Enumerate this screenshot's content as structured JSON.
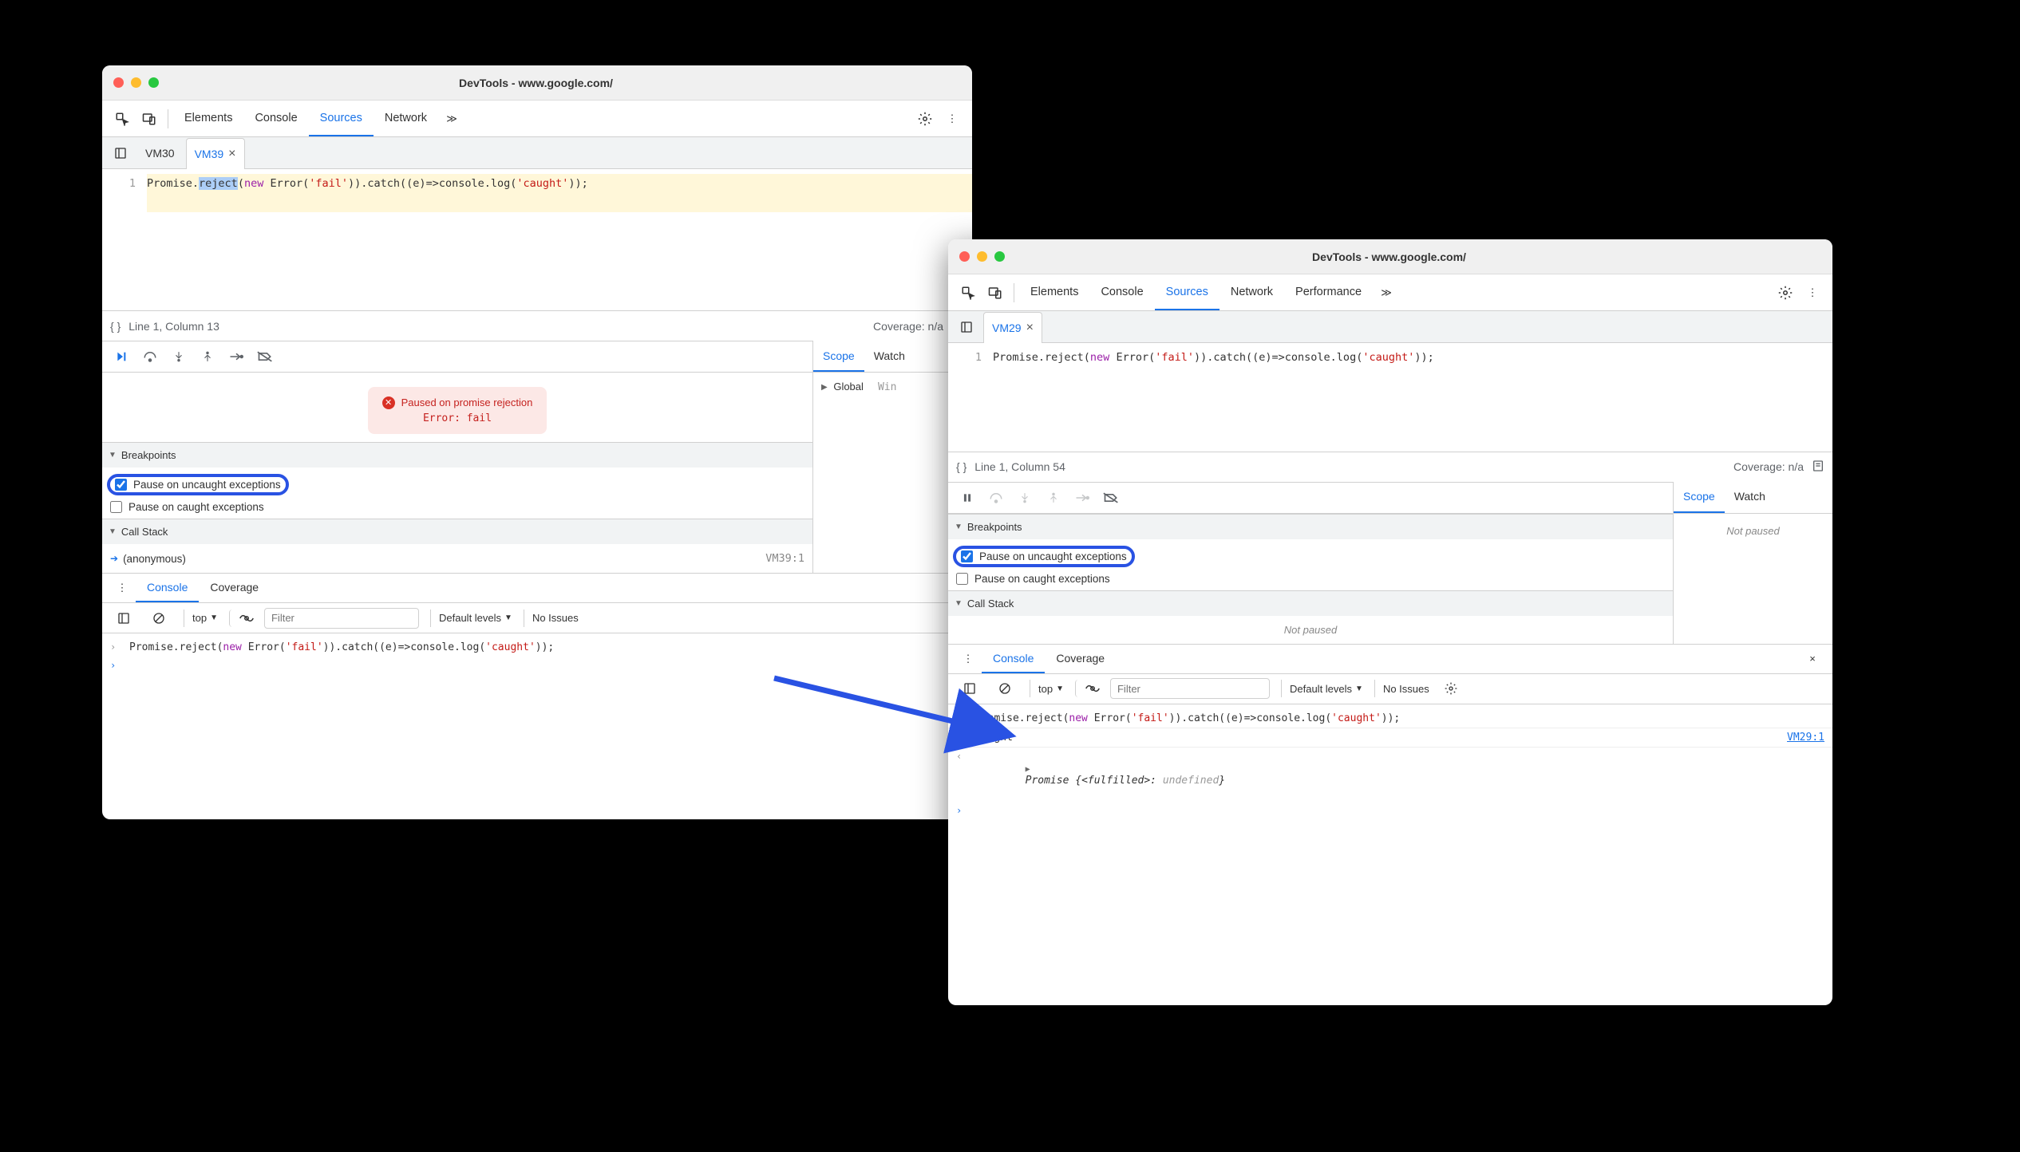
{
  "common": {
    "window_title": "DevTools - www.google.com/",
    "tabs": {
      "elements": "Elements",
      "console": "Console",
      "sources": "Sources",
      "network": "Network",
      "performance": "Performance"
    },
    "coverage": "Coverage: n/a",
    "filter_placeholder": "Filter",
    "default_levels": "Default levels",
    "no_issues": "No Issues",
    "scope": "Scope",
    "watch": "Watch",
    "breakpoints": "Breakpoints",
    "call_stack": "Call Stack",
    "pause_uncaught": "Pause on uncaught exceptions",
    "pause_caught": "Pause on caught exceptions",
    "drawer_console": "Console",
    "drawer_coverage": "Coverage",
    "context_top": "top",
    "not_paused": "Not paused"
  },
  "left": {
    "file_tabs": {
      "inactive": "VM30",
      "active": "VM39"
    },
    "line_num": "1",
    "code": {
      "pre": "Promise.",
      "sel": "reject",
      "mid1": "(",
      "kw1": "new",
      "mid2": " Error(",
      "str1": "'fail'",
      "mid3": ")).catch((e)=>console.log(",
      "str2": "'caught'",
      "mid4": "));"
    },
    "status_line": "Line 1, Column 13",
    "pause_banner": {
      "line1": "Paused on promise rejection",
      "line2": "Error: fail"
    },
    "stack_item": "(anonymous)",
    "stack_source": "VM39:1",
    "scope_global": "Global",
    "scope_global_hint": "Win",
    "console_input": {
      "pre": "Promise.reject(",
      "kw": "new",
      "mid": " Error(",
      "s1": "'fail'",
      "m2": ")).catch((e)=>console.log(",
      "s2": "'caught'",
      "m3": "));"
    }
  },
  "right": {
    "file_tab": "VM29",
    "line_num": "1",
    "code": {
      "pre": "Promise.reject(",
      "kw1": "new",
      "mid2": " Error(",
      "str1": "'fail'",
      "mid3": ")).catch((e)=>console.log(",
      "str2": "'caught'",
      "mid4": "));"
    },
    "status_line": "Line 1, Column 54",
    "console": {
      "input": {
        "pre": "Promise.reject(",
        "kw": "new",
        "mid": " Error(",
        "s1": "'fail'",
        "m2": ")).catch((e)=>console.log(",
        "s2": "'caught'",
        "m3": "));"
      },
      "log_output": "caught",
      "log_source": "VM29:1",
      "return": {
        "pre": "Promise {",
        "ital": "<fulfilled>",
        "mid": ": ",
        "undef": "undefined",
        "post": "}"
      }
    }
  }
}
